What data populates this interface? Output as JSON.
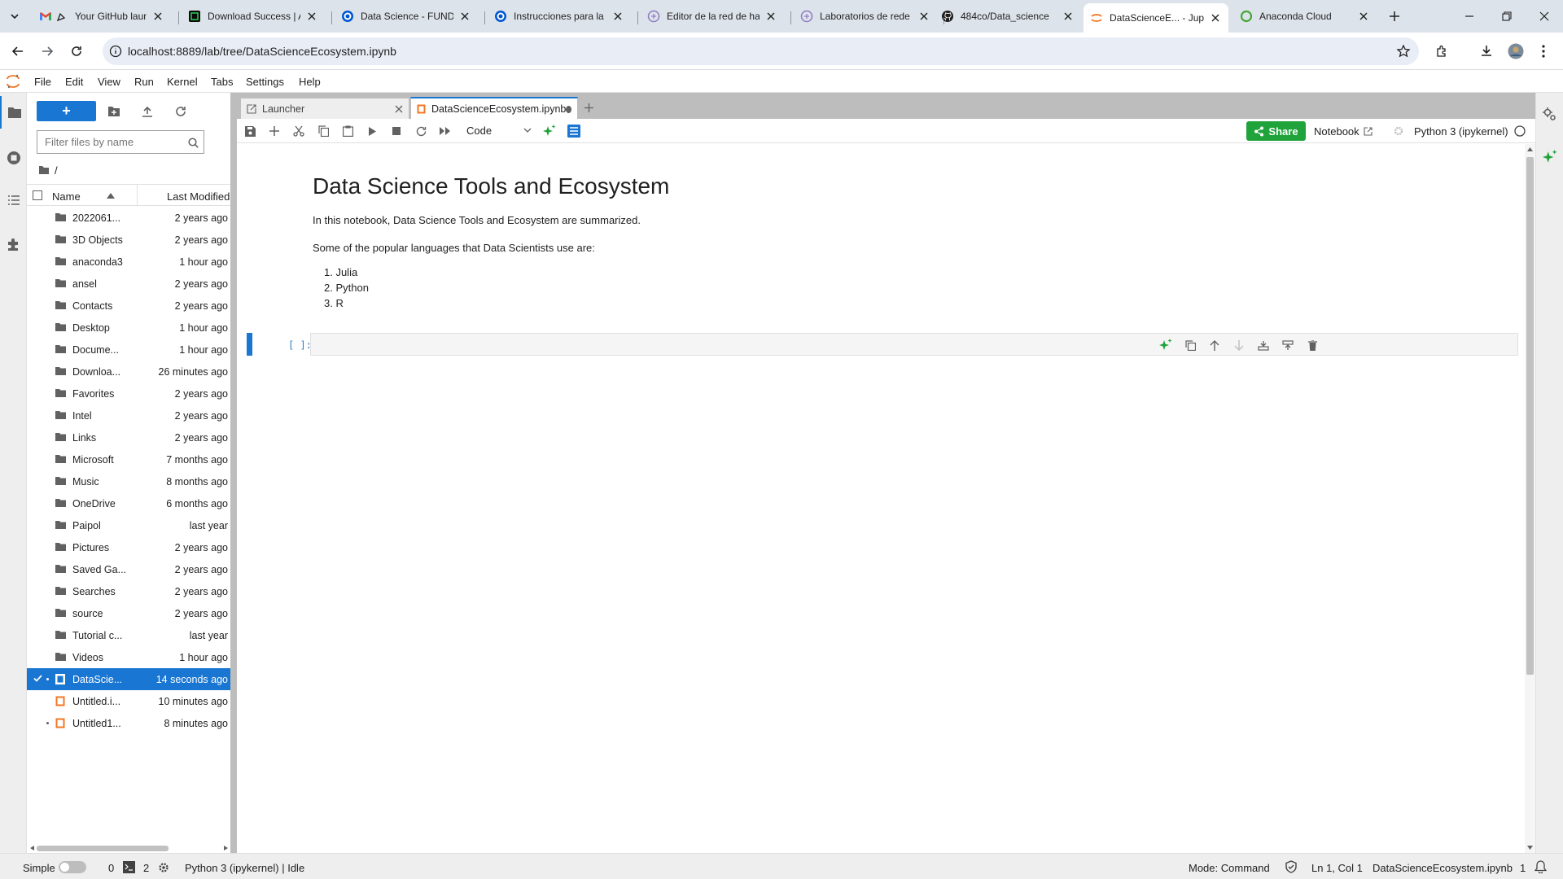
{
  "browser": {
    "tabs": [
      {
        "title": "Your GitHub launch",
        "icon": "gmail-icon"
      },
      {
        "title": "Download Success | A",
        "icon": "download-site-icon"
      },
      {
        "title": "Data Science - FUNDA",
        "icon": "coursera-icon"
      },
      {
        "title": "Instrucciones para la",
        "icon": "coursera-icon"
      },
      {
        "title": "Editor de la red de ha",
        "icon": "skillsnetwork-icon"
      },
      {
        "title": "Laboratorios de rede",
        "icon": "skillsnetwork-icon"
      },
      {
        "title": "484co/Data_science",
        "icon": "github-icon"
      },
      {
        "title": "DataScienceE... - Jupy",
        "icon": "jupyter-icon",
        "active": true
      },
      {
        "title": "Anaconda Cloud",
        "icon": "anaconda-icon"
      }
    ],
    "url": "localhost:8889/lab/tree/DataScienceEcosystem.ipynb"
  },
  "menubar": [
    "File",
    "Edit",
    "View",
    "Run",
    "Kernel",
    "Tabs",
    "Settings",
    "Help"
  ],
  "filebrowser": {
    "new_label": "+",
    "filter_placeholder": "Filter files by name",
    "breadcrumb": "/",
    "col_name": "Name",
    "col_modified": "Last Modified",
    "files": [
      {
        "name": "2022061...",
        "modified": "2 years ago",
        "type": "folder"
      },
      {
        "name": "3D Objects",
        "modified": "2 years ago",
        "type": "folder"
      },
      {
        "name": "anaconda3",
        "modified": "1 hour ago",
        "type": "folder"
      },
      {
        "name": "ansel",
        "modified": "2 years ago",
        "type": "folder"
      },
      {
        "name": "Contacts",
        "modified": "2 years ago",
        "type": "folder"
      },
      {
        "name": "Desktop",
        "modified": "1 hour ago",
        "type": "folder"
      },
      {
        "name": "Docume...",
        "modified": "1 hour ago",
        "type": "folder"
      },
      {
        "name": "Downloa...",
        "modified": "26 minutes ago",
        "type": "folder"
      },
      {
        "name": "Favorites",
        "modified": "2 years ago",
        "type": "folder"
      },
      {
        "name": "Intel",
        "modified": "2 years ago",
        "type": "folder"
      },
      {
        "name": "Links",
        "modified": "2 years ago",
        "type": "folder"
      },
      {
        "name": "Microsoft",
        "modified": "7 months ago",
        "type": "folder"
      },
      {
        "name": "Music",
        "modified": "8 months ago",
        "type": "folder"
      },
      {
        "name": "OneDrive",
        "modified": "6 months ago",
        "type": "folder"
      },
      {
        "name": "Paipol",
        "modified": "last year",
        "type": "folder"
      },
      {
        "name": "Pictures",
        "modified": "2 years ago",
        "type": "folder"
      },
      {
        "name": "Saved Ga...",
        "modified": "2 years ago",
        "type": "folder"
      },
      {
        "name": "Searches",
        "modified": "2 years ago",
        "type": "folder"
      },
      {
        "name": "source",
        "modified": "2 years ago",
        "type": "folder"
      },
      {
        "name": "Tutorial c...",
        "modified": "last year",
        "type": "folder"
      },
      {
        "name": "Videos",
        "modified": "1 hour ago",
        "type": "folder"
      },
      {
        "name": "DataScie...",
        "modified": "14 seconds ago",
        "type": "notebook",
        "selected": true,
        "running": true
      },
      {
        "name": "Untitled.i...",
        "modified": "10 minutes ago",
        "type": "notebook"
      },
      {
        "name": "Untitled1...",
        "modified": "8 minutes ago",
        "type": "notebook",
        "running": true
      }
    ]
  },
  "dock": {
    "tabs": [
      {
        "title": "Launcher"
      },
      {
        "title": "DataScienceEcosystem.ipynb",
        "active": true,
        "dirty": true
      }
    ]
  },
  "notebook": {
    "cell_type": "Code",
    "share_label": "Share",
    "notebook_label": "Notebook",
    "kernel_name": "Python 3 (ipykernel)",
    "heading": "Data Science Tools and Ecosystem",
    "intro": "In this notebook, Data Science Tools and Ecosystem are summarized.",
    "languages_intro": "Some of the popular languages that Data Scientists use are:",
    "languages": [
      "1. Julia",
      "2. Python",
      "3. R"
    ],
    "code_prompt": "[ ]:"
  },
  "statusbar": {
    "mode_label": "Simple",
    "terminals": "0",
    "kernels": "2",
    "kernel_status": "Python 3 (ipykernel) | Idle",
    "mode": "Mode: Command",
    "cursor": "Ln 1, Col 1",
    "file": "DataScienceEcosystem.ipynb",
    "notifications": "1"
  },
  "colors": {
    "accent": "#1976d2",
    "share": "#20a33b",
    "ai": "#20a33b"
  }
}
